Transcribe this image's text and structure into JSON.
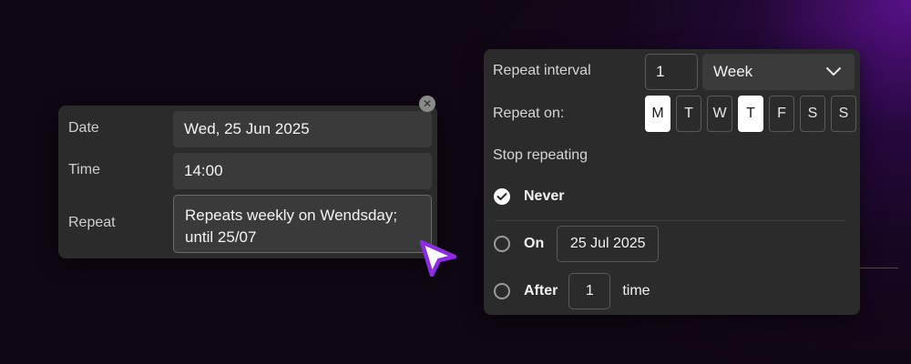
{
  "event": {
    "date_label": "Date",
    "date_value": "Wed, 25 Jun 2025",
    "time_label": "Time",
    "time_value": "14:00",
    "repeat_label": "Repeat",
    "repeat_value": "Repeats weekly on Wendsday;\nuntil 25/07",
    "close_icon": "close-icon"
  },
  "repeat_panel": {
    "interval_label": "Repeat interval",
    "interval_value": "1",
    "unit_value": "Week",
    "repeat_on_label": "Repeat on:",
    "days": [
      {
        "label": "M",
        "selected": true
      },
      {
        "label": "T",
        "selected": false
      },
      {
        "label": "W",
        "selected": false
      },
      {
        "label": "T",
        "selected": true
      },
      {
        "label": "F",
        "selected": false
      },
      {
        "label": "S",
        "selected": false
      },
      {
        "label": "S",
        "selected": false
      }
    ],
    "stop_label": "Stop repeating",
    "options": {
      "never_label": "Never",
      "on_label": "On",
      "on_date": "25 Jul 2025",
      "after_label": "After",
      "after_count": "1",
      "after_suffix": "time"
    },
    "selected_option": "never"
  },
  "colors": {
    "accent_cursor": "#8b2be2",
    "selected_day_bg": "#ffffff"
  }
}
